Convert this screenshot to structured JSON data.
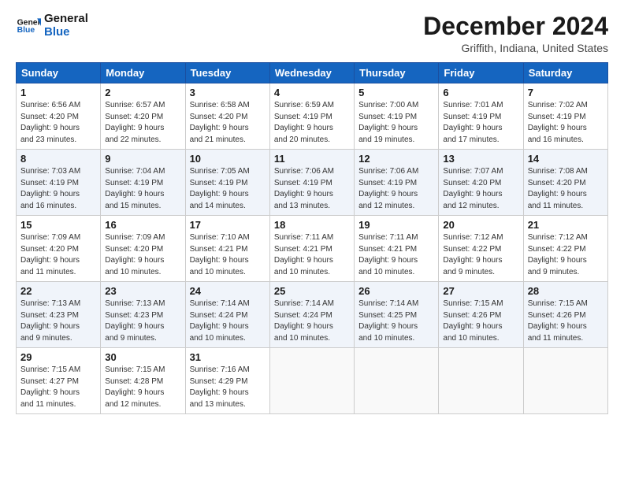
{
  "header": {
    "logo_line1": "General",
    "logo_line2": "Blue",
    "title": "December 2024",
    "subtitle": "Griffith, Indiana, United States"
  },
  "weekdays": [
    "Sunday",
    "Monday",
    "Tuesday",
    "Wednesday",
    "Thursday",
    "Friday",
    "Saturday"
  ],
  "weeks": [
    [
      {
        "day": "1",
        "sunrise": "6:56 AM",
        "sunset": "4:20 PM",
        "daylight": "9 hours and 23 minutes."
      },
      {
        "day": "2",
        "sunrise": "6:57 AM",
        "sunset": "4:20 PM",
        "daylight": "9 hours and 22 minutes."
      },
      {
        "day": "3",
        "sunrise": "6:58 AM",
        "sunset": "4:20 PM",
        "daylight": "9 hours and 21 minutes."
      },
      {
        "day": "4",
        "sunrise": "6:59 AM",
        "sunset": "4:19 PM",
        "daylight": "9 hours and 20 minutes."
      },
      {
        "day": "5",
        "sunrise": "7:00 AM",
        "sunset": "4:19 PM",
        "daylight": "9 hours and 19 minutes."
      },
      {
        "day": "6",
        "sunrise": "7:01 AM",
        "sunset": "4:19 PM",
        "daylight": "9 hours and 17 minutes."
      },
      {
        "day": "7",
        "sunrise": "7:02 AM",
        "sunset": "4:19 PM",
        "daylight": "9 hours and 16 minutes."
      }
    ],
    [
      {
        "day": "8",
        "sunrise": "7:03 AM",
        "sunset": "4:19 PM",
        "daylight": "9 hours and 16 minutes."
      },
      {
        "day": "9",
        "sunrise": "7:04 AM",
        "sunset": "4:19 PM",
        "daylight": "9 hours and 15 minutes."
      },
      {
        "day": "10",
        "sunrise": "7:05 AM",
        "sunset": "4:19 PM",
        "daylight": "9 hours and 14 minutes."
      },
      {
        "day": "11",
        "sunrise": "7:06 AM",
        "sunset": "4:19 PM",
        "daylight": "9 hours and 13 minutes."
      },
      {
        "day": "12",
        "sunrise": "7:06 AM",
        "sunset": "4:19 PM",
        "daylight": "9 hours and 12 minutes."
      },
      {
        "day": "13",
        "sunrise": "7:07 AM",
        "sunset": "4:20 PM",
        "daylight": "9 hours and 12 minutes."
      },
      {
        "day": "14",
        "sunrise": "7:08 AM",
        "sunset": "4:20 PM",
        "daylight": "9 hours and 11 minutes."
      }
    ],
    [
      {
        "day": "15",
        "sunrise": "7:09 AM",
        "sunset": "4:20 PM",
        "daylight": "9 hours and 11 minutes."
      },
      {
        "day": "16",
        "sunrise": "7:09 AM",
        "sunset": "4:20 PM",
        "daylight": "9 hours and 10 minutes."
      },
      {
        "day": "17",
        "sunrise": "7:10 AM",
        "sunset": "4:21 PM",
        "daylight": "9 hours and 10 minutes."
      },
      {
        "day": "18",
        "sunrise": "7:11 AM",
        "sunset": "4:21 PM",
        "daylight": "9 hours and 10 minutes."
      },
      {
        "day": "19",
        "sunrise": "7:11 AM",
        "sunset": "4:21 PM",
        "daylight": "9 hours and 10 minutes."
      },
      {
        "day": "20",
        "sunrise": "7:12 AM",
        "sunset": "4:22 PM",
        "daylight": "9 hours and 9 minutes."
      },
      {
        "day": "21",
        "sunrise": "7:12 AM",
        "sunset": "4:22 PM",
        "daylight": "9 hours and 9 minutes."
      }
    ],
    [
      {
        "day": "22",
        "sunrise": "7:13 AM",
        "sunset": "4:23 PM",
        "daylight": "9 hours and 9 minutes."
      },
      {
        "day": "23",
        "sunrise": "7:13 AM",
        "sunset": "4:23 PM",
        "daylight": "9 hours and 9 minutes."
      },
      {
        "day": "24",
        "sunrise": "7:14 AM",
        "sunset": "4:24 PM",
        "daylight": "9 hours and 10 minutes."
      },
      {
        "day": "25",
        "sunrise": "7:14 AM",
        "sunset": "4:24 PM",
        "daylight": "9 hours and 10 minutes."
      },
      {
        "day": "26",
        "sunrise": "7:14 AM",
        "sunset": "4:25 PM",
        "daylight": "9 hours and 10 minutes."
      },
      {
        "day": "27",
        "sunrise": "7:15 AM",
        "sunset": "4:26 PM",
        "daylight": "9 hours and 10 minutes."
      },
      {
        "day": "28",
        "sunrise": "7:15 AM",
        "sunset": "4:26 PM",
        "daylight": "9 hours and 11 minutes."
      }
    ],
    [
      {
        "day": "29",
        "sunrise": "7:15 AM",
        "sunset": "4:27 PM",
        "daylight": "9 hours and 11 minutes."
      },
      {
        "day": "30",
        "sunrise": "7:15 AM",
        "sunset": "4:28 PM",
        "daylight": "9 hours and 12 minutes."
      },
      {
        "day": "31",
        "sunrise": "7:16 AM",
        "sunset": "4:29 PM",
        "daylight": "9 hours and 13 minutes."
      },
      null,
      null,
      null,
      null
    ]
  ]
}
